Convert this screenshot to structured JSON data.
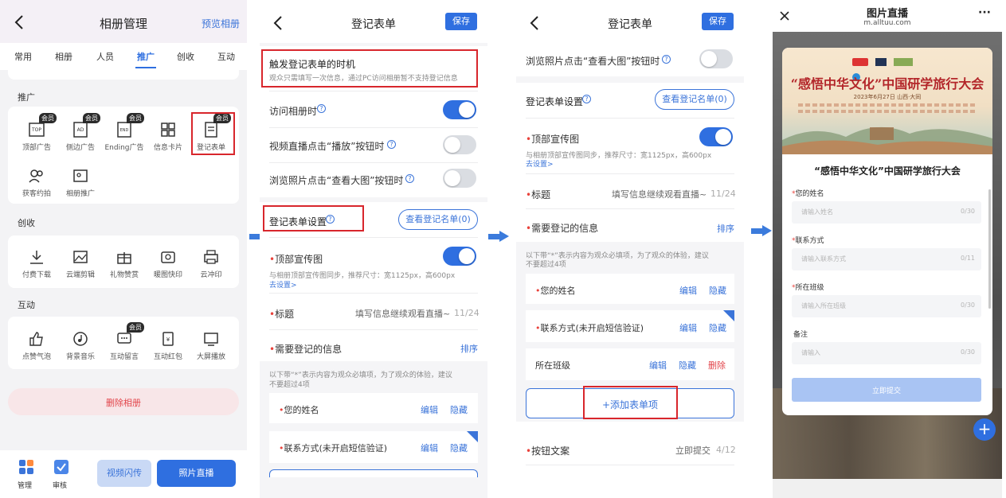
{
  "p1": {
    "title": "相册管理",
    "preview": "预览相册",
    "tabs": [
      "常用",
      "相册",
      "人员",
      "推广",
      "创收",
      "互动"
    ],
    "section_promo": "推广",
    "promo_items": [
      {
        "label": "顶部广告",
        "vip": "会员"
      },
      {
        "label": "侧边广告",
        "vip": "会员"
      },
      {
        "label": "Ending广告",
        "vip": "会员"
      },
      {
        "label": "信息卡片",
        "vip": ""
      },
      {
        "label": "登记表单",
        "vip": "会员"
      },
      {
        "label": "获客约拍",
        "vip": ""
      },
      {
        "label": "相册推广",
        "vip": ""
      }
    ],
    "section_revenue": "创收",
    "revenue_items": [
      "付费下载",
      "云端剪辑",
      "礼物赞赏",
      "暖图快印",
      "云冲印"
    ],
    "section_interact": "互动",
    "interact_items": [
      {
        "label": "点赞气泡",
        "vip": ""
      },
      {
        "label": "背景音乐",
        "vip": ""
      },
      {
        "label": "互动留言",
        "vip": "会员"
      },
      {
        "label": "互动红包",
        "vip": ""
      },
      {
        "label": "大屏播放",
        "vip": ""
      }
    ],
    "delete_album": "删除相册",
    "bottom_manage": "管理",
    "bottom_review": "审核",
    "btn_video": "视频闪传",
    "btn_live": "照片直播"
  },
  "p2": {
    "title": "登记表单",
    "save": "保存",
    "trigger_title": "触发登记表单的时机",
    "trigger_desc": "观众只需填写一次信息，通过PC访问相册暂不支持登记信息",
    "visit_album": "访问相册时",
    "video_play": "视频直播点击“播放”按钮时",
    "browse_photo": "浏览照片点击“查看大图”按钮时",
    "form_settings": "登记表单设置",
    "view_list": "查看登记名单(0)",
    "top_banner": "顶部宣传图",
    "top_banner_desc": "与相册顶部宣传图同步，推荐尺寸：宽1125px，高600px",
    "go_set": "去设置>",
    "title_label": "标题",
    "title_value": "填写信息继续观看直播~",
    "title_count": "11/24",
    "need_info": "需要登记的信息",
    "sort": "排序",
    "need_desc_1": "以下带“*”表示内容为观众必填项，为了观众的体验，建议",
    "need_desc_2": "不要超过4项",
    "field_name": "您的姓名",
    "field_contact": "联系方式(未开启短信验证)",
    "edit": "编辑",
    "hide": "隐藏"
  },
  "p3": {
    "title": "登记表单",
    "save": "保存",
    "browse_photo": "浏览照片点击“查看大图”按钮时",
    "form_settings": "登记表单设置",
    "view_list": "查看登记名单(0)",
    "top_banner": "顶部宣传图",
    "top_banner_desc": "与相册顶部宣传图同步，推荐尺寸：宽1125px，高600px",
    "go_set": "去设置>",
    "title_label": "标题",
    "title_value": "填写信息继续观看直播~",
    "title_count": "11/24",
    "need_info": "需要登记的信息",
    "sort": "排序",
    "need_desc_1": "以下带“*”表示内容为观众必填项，为了观众的体验，建议",
    "need_desc_2": "不要超过4项",
    "field_name": "您的姓名",
    "field_contact": "联系方式(未开启短信验证)",
    "field_class": "所在班级",
    "edit": "编辑",
    "hide": "隐藏",
    "delete": "删除",
    "add_item": "+添加表单项",
    "btn_text_label": "按钮文案",
    "btn_text_value": "立即提交",
    "btn_text_count": "4/12"
  },
  "p4": {
    "title": "图片直播",
    "url": "m.alltuu.com",
    "banner_title": "“感悟中华文化”中国研学旅行大会",
    "banner_date": "2023年6月27日   山西·大同",
    "form_title": "“感悟中华文化”中国研学旅行大会",
    "f_name_label": "您的姓名",
    "f_name_ph": "请输入姓名",
    "f_name_count": "0/30",
    "f_contact_label": "联系方式",
    "f_contact_ph": "请输入联系方式",
    "f_contact_count": "0/11",
    "f_class_label": "所在班级",
    "f_class_ph": "请输入所在班级",
    "f_class_count": "0/30",
    "f_note_label": "备注",
    "f_note_ph": "请输入",
    "f_note_count": "0/30",
    "submit": "立即提交"
  },
  "colors": {
    "accent": "#2f6fe0",
    "highlight_box": "#d8262c",
    "required": "#e9423b"
  }
}
